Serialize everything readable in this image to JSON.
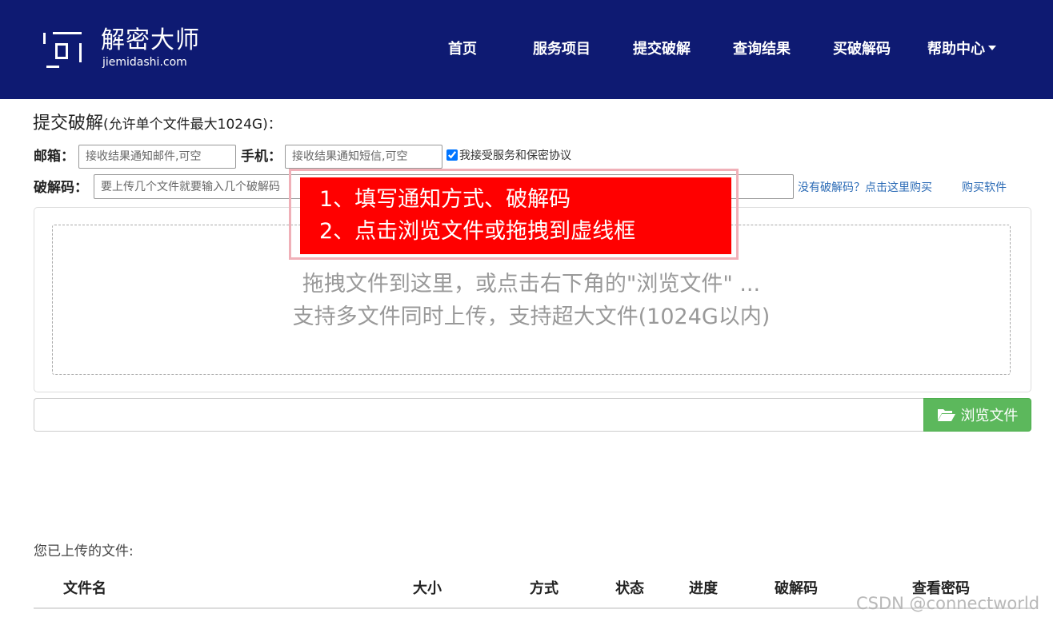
{
  "brand": {
    "name": "解密大师",
    "domain": "jiemidashi.com",
    "header_bg": "#0e1a72"
  },
  "nav": {
    "items": [
      {
        "label": "首页"
      },
      {
        "label": "服务项目"
      },
      {
        "label": "提交破解"
      },
      {
        "label": "查询结果"
      },
      {
        "label": "买破解码"
      },
      {
        "label": "帮助中心"
      }
    ]
  },
  "form": {
    "title": "提交破解",
    "title_note": "(允许单个文件最大1024G)：",
    "email_label": "邮箱：",
    "email_placeholder": "接收结果通知邮件,可空",
    "phone_label": "手机：",
    "phone_placeholder": "接收结果通知短信,可空",
    "agree_text": "我接受服务和保密协议",
    "agree_checked": true,
    "code_label": "破解码：",
    "code_placeholder": "要上传几个文件就要输入几个破解码",
    "no_code_link": "没有破解码？点击这里购买",
    "buy_software_link": "购买软件"
  },
  "dropzone": {
    "line1": "拖拽文件到这里，或点击右下角的\"浏览文件\" ...",
    "line2": "支持多文件同时上传，支持超大文件(1024G以内)"
  },
  "browse": {
    "label": "浏览文件",
    "color": "#5cb85c"
  },
  "annotation": {
    "line1": "1、填写通知方式、破解码",
    "line2": "2、点击浏览文件或拖拽到虚线框",
    "color": "#ff0000"
  },
  "uploaded": {
    "title": "您已上传的文件:",
    "columns": [
      "文件名",
      "大小",
      "方式",
      "状态",
      "进度",
      "破解码",
      "查看密码"
    ]
  },
  "watermark": "CSDN @connectworld"
}
